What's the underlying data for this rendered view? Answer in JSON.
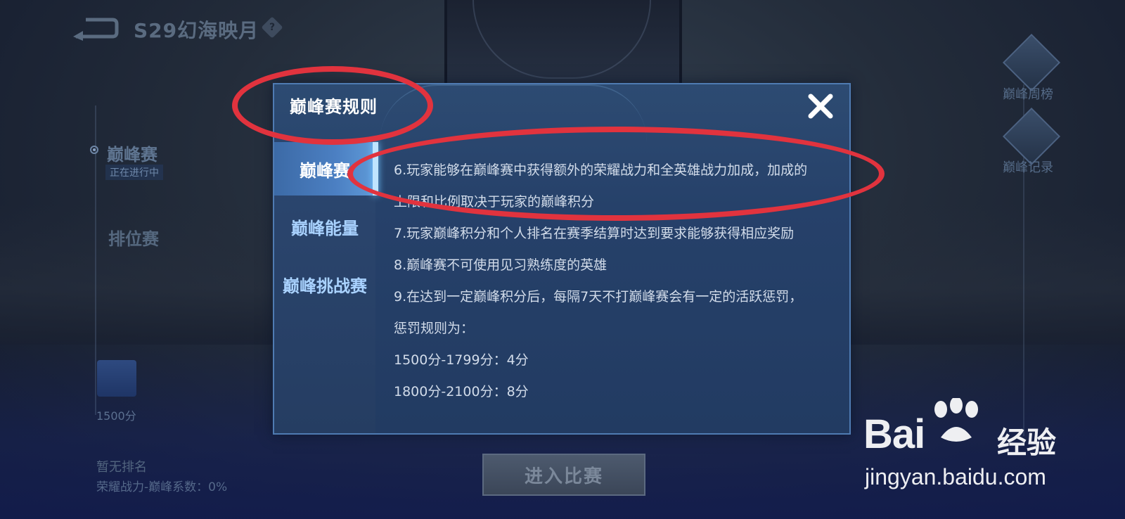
{
  "header": {
    "season_title": "S29幻海映月",
    "help_glyph": "?"
  },
  "sidebar": {
    "peak_mode": "巅峰赛",
    "peak_status": "正在进行中",
    "ranked_mode": "排位赛",
    "score": "1500分",
    "no_rank": "暂无排名",
    "honor_coefficient": "荣耀战力-巅峰系数：0%"
  },
  "right_menu": {
    "weekly_ranking": "巅峰周榜",
    "peak_record": "巅峰记录"
  },
  "enter_button": "进入比赛",
  "dialog": {
    "title": "巅峰赛规则",
    "tabs": [
      "巅峰赛",
      "巅峰能量",
      "巅峰挑战赛"
    ],
    "active_tab": "巅峰赛",
    "rules": [
      "6.玩家能够在巅峰赛中获得额外的荣耀战力和全英雄战力加成，加成的",
      "上限和比例取决于玩家的巅峰积分",
      "7.玩家巅峰积分和个人排名在赛季结算时达到要求能够获得相应奖励",
      "8.巅峰赛不可使用见习熟练度的英雄",
      "9.在达到一定巅峰积分后，每隔7天不打巅峰赛会有一定的活跃惩罚，",
      "惩罚规则为：",
      "1500分-1799分：4分",
      "1800分-2100分：8分"
    ]
  },
  "watermark": {
    "logo": "Bai",
    "logo_suffix": "经验",
    "url": "jingyan.baidu.com"
  },
  "colors": {
    "annotation": "#e1333e",
    "dialog_bg": "#26416a",
    "tab_text": "#a9d2ff"
  }
}
